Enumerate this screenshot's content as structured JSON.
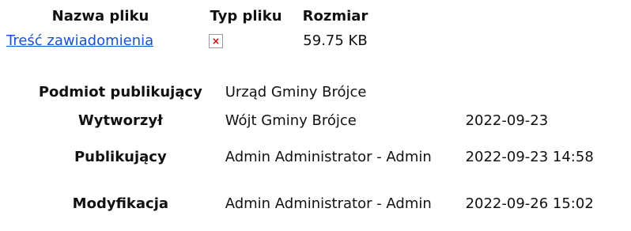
{
  "files": {
    "headers": {
      "name": "Nazwa pliku",
      "type": "Typ pliku",
      "size": "Rozmiar"
    },
    "rows": [
      {
        "name": "Treść zawiadomienia",
        "type_icon": "broken-image-icon",
        "size": "59.75 KB"
      }
    ]
  },
  "meta": {
    "publisher": {
      "label": "Podmiot publikujący",
      "value": "Urząd Gminy Brójce"
    },
    "created": {
      "label": "Wytworzył",
      "value": "Wójt Gminy Brójce",
      "date": "2022-09-23"
    },
    "published": {
      "label": "Publikujący",
      "value": "Admin Administrator - Admin",
      "date": "2022-09-23 14:58"
    },
    "modified": {
      "label": "Modyfikacja",
      "value": "Admin Administrator - Admin",
      "date": "2022-09-26 15:02"
    }
  },
  "colors": {
    "link": "#1a4fd8",
    "broken_icon_mark": "#d40000"
  }
}
